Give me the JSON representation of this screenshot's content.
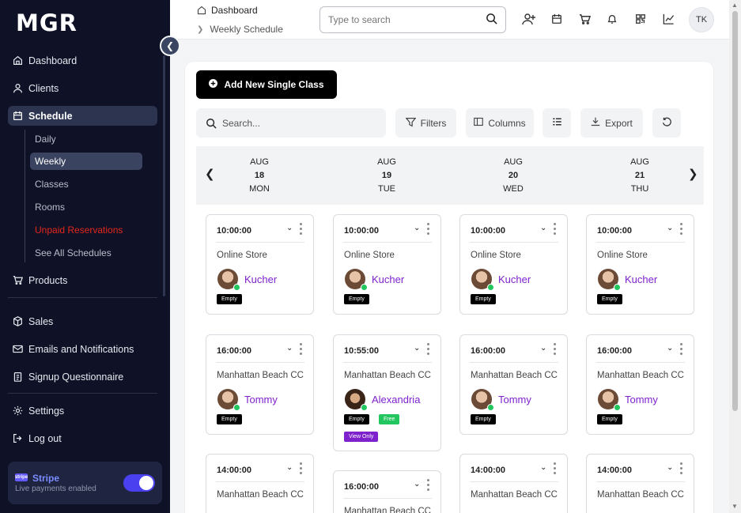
{
  "app": {
    "logo": "MGR"
  },
  "sidebar": {
    "items": [
      {
        "label": "Dashboard"
      },
      {
        "label": "Clients"
      },
      {
        "label": "Schedule"
      },
      {
        "label": "Products"
      },
      {
        "label": "Sales"
      },
      {
        "label": "Emails and Notifications"
      },
      {
        "label": "Signup Questionnaire"
      },
      {
        "label": "Settings"
      },
      {
        "label": "Log out"
      }
    ],
    "schedule_sub": [
      {
        "label": "Daily"
      },
      {
        "label": "Weekly"
      },
      {
        "label": "Classes"
      },
      {
        "label": "Rooms"
      },
      {
        "label": "Unpaid Reservations"
      },
      {
        "label": "See All Schedules"
      }
    ],
    "stripe": {
      "logo_text": "stripe",
      "title": "Stripe",
      "subtitle": "Live payments enabled",
      "enabled": true
    }
  },
  "header": {
    "breadcrumb": [
      "Dashboard",
      "Weekly Schedule"
    ],
    "search_placeholder": "Type to search",
    "avatar_initials": "TK"
  },
  "toolbar": {
    "add_label": "Add New Single Class",
    "search_placeholder": "Search...",
    "filters_label": "Filters",
    "columns_label": "Columns",
    "export_label": "Export"
  },
  "days": [
    {
      "month": "AUG",
      "date": "18",
      "weekday": "MON"
    },
    {
      "month": "AUG",
      "date": "19",
      "weekday": "TUE"
    },
    {
      "month": "AUG",
      "date": "20",
      "weekday": "WED"
    },
    {
      "month": "AUG",
      "date": "21",
      "weekday": "THU"
    }
  ],
  "cards": [
    {
      "time": "10:00:00",
      "location": "Online Store",
      "instructor": "Kucher",
      "badges": [
        "Empty"
      ]
    },
    {
      "time": "10:00:00",
      "location": "Online Store",
      "instructor": "Kucher",
      "badges": [
        "Empty"
      ]
    },
    {
      "time": "10:00:00",
      "location": "Online Store",
      "instructor": "Kucher",
      "badges": [
        "Empty"
      ]
    },
    {
      "time": "10:00:00",
      "location": "Online Store",
      "instructor": "Kucher",
      "badges": [
        "Empty"
      ]
    },
    {
      "time": "16:00:00",
      "location": "Manhattan Beach CC",
      "instructor": "Tommy",
      "badges": [
        "Empty"
      ]
    },
    {
      "time": "10:55:00",
      "location": "Manhattan Beach CC",
      "instructor": "Alexandria",
      "badges": [
        "Empty",
        "Free",
        "View Only"
      ]
    },
    {
      "time": "16:00:00",
      "location": "Manhattan Beach CC",
      "instructor": "Tommy",
      "badges": [
        "Empty"
      ]
    },
    {
      "time": "16:00:00",
      "location": "Manhattan Beach CC",
      "instructor": "Tommy",
      "badges": [
        "Empty"
      ]
    },
    {
      "time": "14:00:00",
      "location": "Manhattan Beach CC"
    },
    {
      "time": "16:00:00",
      "location": "Manhattan Beach CC"
    },
    {
      "time": "14:00:00",
      "location": "Manhattan Beach CC"
    },
    {
      "time": "14:00:00",
      "location": "Manhattan Beach CC"
    }
  ],
  "colors": {
    "sidebar_bg": "#0f1226",
    "accent_purple": "#7e22ce",
    "badge_free": "#22c55e",
    "stripe_toggle": "#4b40f0"
  }
}
